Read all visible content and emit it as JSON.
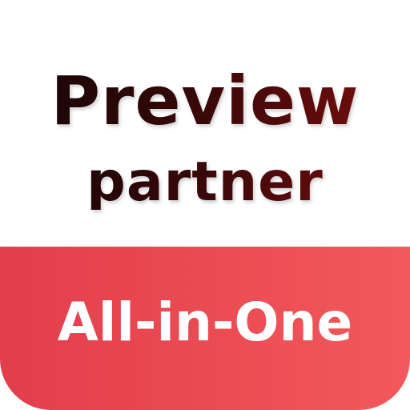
{
  "title": {
    "line1": "Preview",
    "line2": "partner"
  },
  "band": {
    "label": "All-in-One"
  },
  "colors": {
    "background": "#ffffff",
    "title_dark": "#140505",
    "title_red": "#7a0e0e",
    "band_start": "#e23e4c",
    "band_end": "#f2595b",
    "band_text": "#ffffff"
  }
}
